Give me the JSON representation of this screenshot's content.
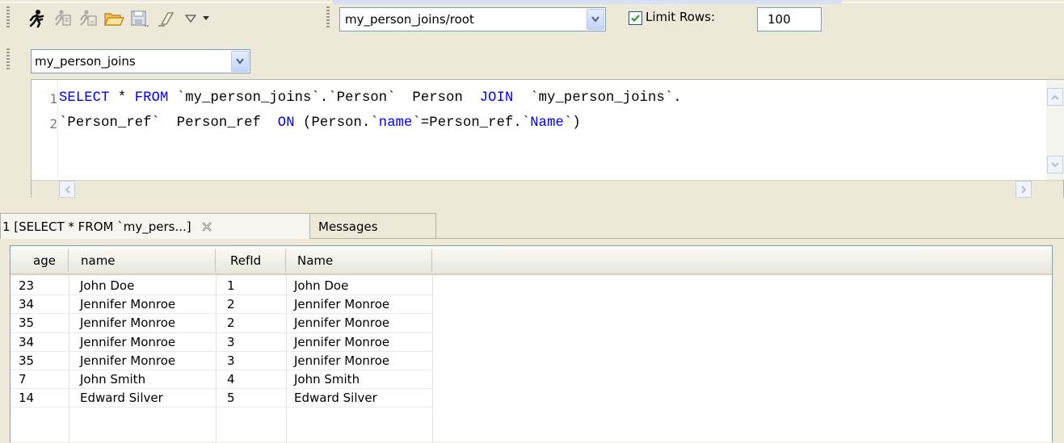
{
  "toolbar": {
    "icons": [
      "execute-icon",
      "execute-current-icon",
      "explain-icon",
      "open-file-icon",
      "save-icon",
      "clear-icon",
      "dropdown-arrow-icon",
      "small-dropdown-icon"
    ],
    "connection_combo": "my_person_joins/root",
    "limit_rows_label": "Limit Rows:",
    "limit_rows_checked": true,
    "limit_rows_value": "100",
    "database_combo": "my_person_joins"
  },
  "editor": {
    "line_numbers": [
      "1",
      "2"
    ],
    "line1": {
      "select": "SELECT",
      "star": " * ",
      "from": "FROM",
      "rest": " `my_person_joins`.`Person`  Person  ",
      "join": "JOIN",
      "tail": "  `my_person_joins`."
    },
    "line2": {
      "head": "`Person_ref`  Person_ref  ",
      "on": "ON",
      "part1": " (Person.`",
      "col1": "name",
      "part2": "`=Person_ref.`",
      "col2": "Name",
      "part3": "`)"
    }
  },
  "results": {
    "tabs": [
      {
        "label": "1 [SELECT * FROM `my_pers...]"
      },
      {
        "label": "Messages"
      }
    ],
    "columns": [
      "age",
      "name",
      "RefId",
      "Name"
    ],
    "rows": [
      [
        "23",
        "John Doe",
        "1",
        "John Doe"
      ],
      [
        "34",
        "Jennifer Monroe",
        "2",
        "Jennifer Monroe"
      ],
      [
        "35",
        "Jennifer Monroe",
        "2",
        "Jennifer Monroe"
      ],
      [
        "34",
        "Jennifer Monroe",
        "3",
        "Jennifer Monroe"
      ],
      [
        "35",
        "Jennifer Monroe",
        "3",
        "Jennifer Monroe"
      ],
      [
        "7",
        "John Smith",
        "4",
        "John Smith"
      ],
      [
        "14",
        "Edward Silver",
        "5",
        "Edward Silver"
      ]
    ]
  },
  "colors": {
    "keyword": "#0000ff",
    "window_bg": "#ece9d8",
    "combo_border": "#7f9db9"
  }
}
